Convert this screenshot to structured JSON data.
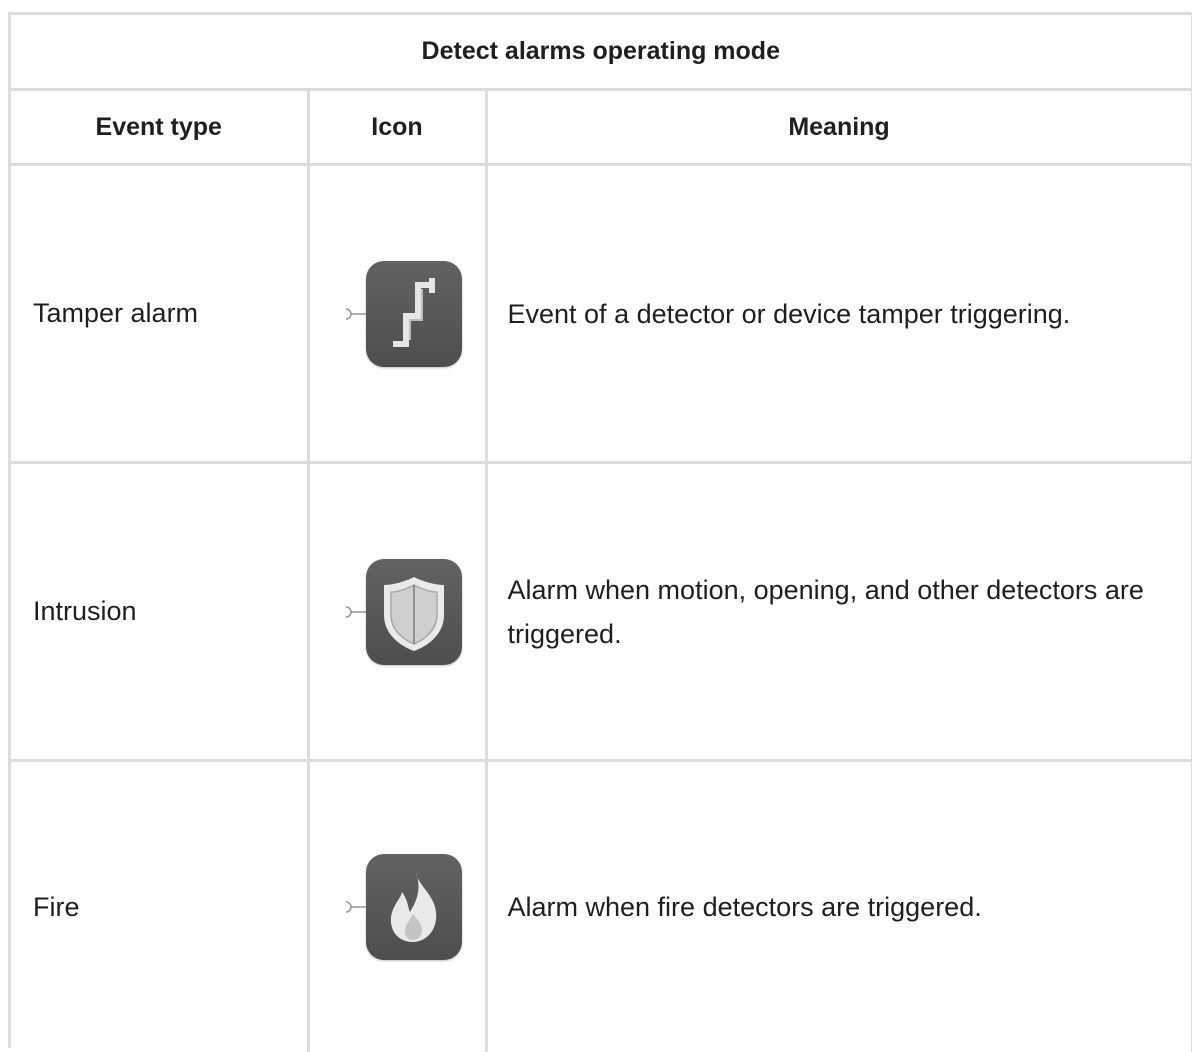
{
  "table": {
    "title": "Detect alarms operating mode",
    "headers": [
      "Event type",
      "Icon",
      "Meaning"
    ],
    "rows": [
      {
        "event_type": "Tamper alarm",
        "icon": "tamper-icon",
        "meaning": "Event of a detector or device tamper triggering."
      },
      {
        "event_type": "Intrusion",
        "icon": "shield-icon",
        "meaning": "Alarm when motion, opening, and other detectors are triggered."
      },
      {
        "event_type": "Fire",
        "icon": "fire-icon",
        "meaning": "Alarm when fire detectors are triggered."
      }
    ]
  },
  "colors": {
    "border": "#dcdcdc",
    "icon_background": "#555555",
    "icon_glyph": "#e8e8e8",
    "text": "#1f1f1f"
  }
}
